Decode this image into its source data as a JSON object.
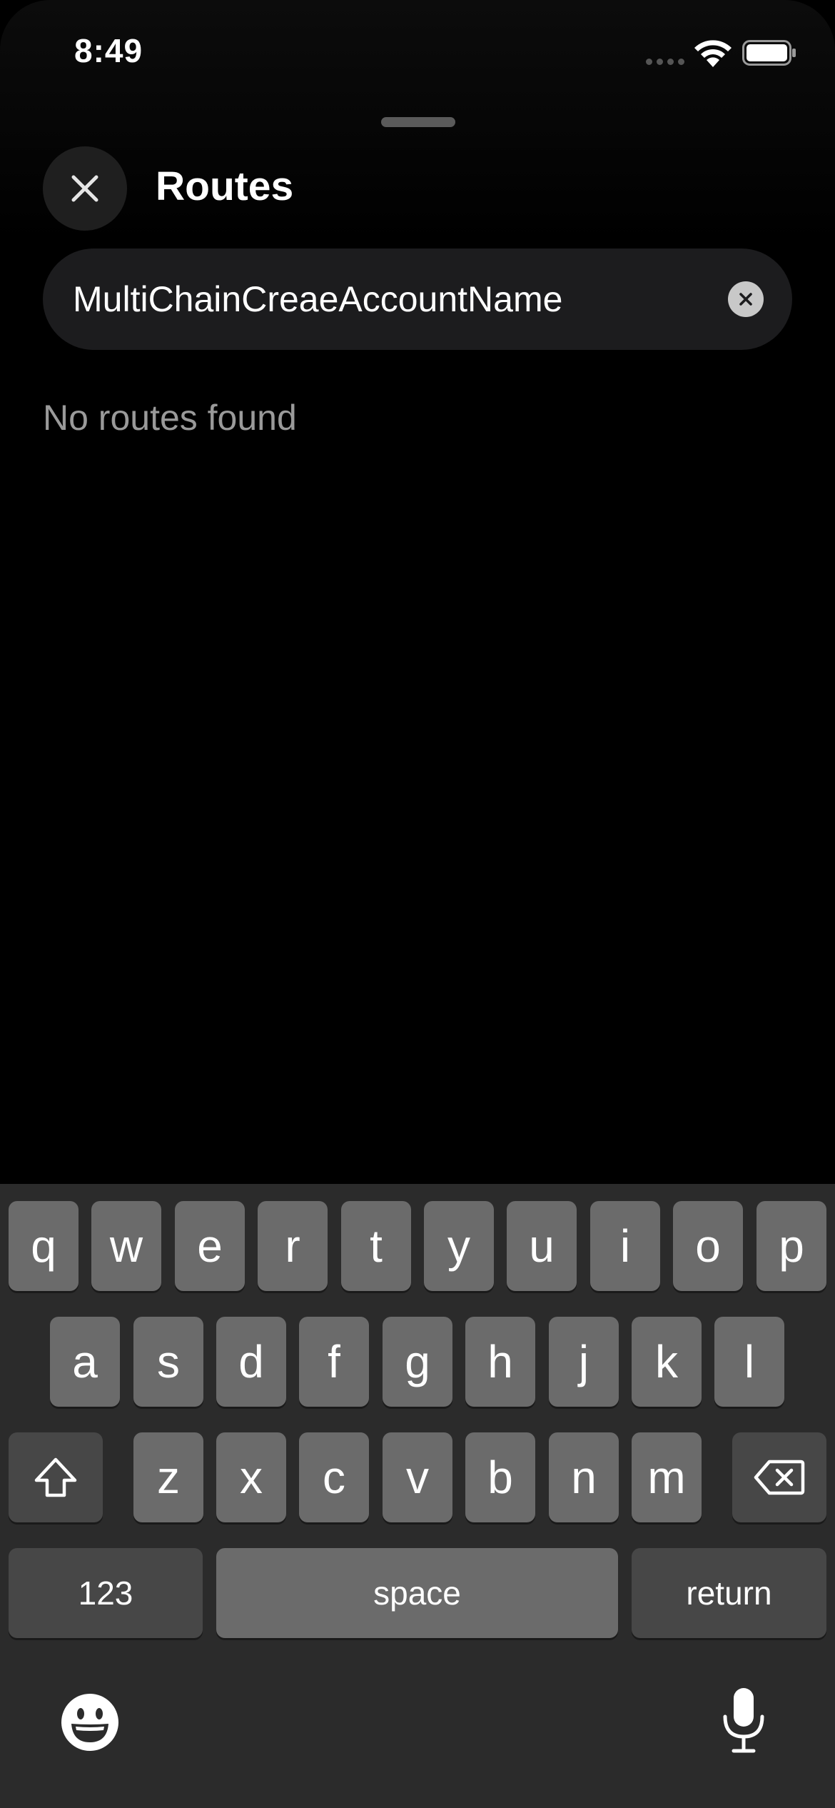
{
  "status_bar": {
    "time": "8:49",
    "signal_icon": "signal-dots-icon",
    "wifi_icon": "wifi-icon",
    "battery_icon": "battery-icon"
  },
  "header": {
    "title": "Routes",
    "close_icon": "close-icon"
  },
  "search": {
    "value": "MultiChainCreaeAccountName",
    "clear_icon": "clear-icon"
  },
  "results": {
    "empty_message": "No routes found"
  },
  "keyboard": {
    "row1": [
      "q",
      "w",
      "e",
      "r",
      "t",
      "y",
      "u",
      "i",
      "o",
      "p"
    ],
    "row2": [
      "a",
      "s",
      "d",
      "f",
      "g",
      "h",
      "j",
      "k",
      "l"
    ],
    "row3": [
      "z",
      "x",
      "c",
      "v",
      "b",
      "n",
      "m"
    ],
    "numbers_label": "123",
    "space_label": "space",
    "return_label": "return",
    "shift_icon": "shift-icon",
    "delete_icon": "delete-icon",
    "emoji_icon": "emoji-icon",
    "mic_icon": "microphone-icon"
  },
  "colors": {
    "background": "#000000",
    "field_background": "#1c1c1e",
    "keyboard_background": "#2b2b2b",
    "key_light": "#6b6b6b",
    "key_dark": "#474747",
    "muted_text": "#9a9a9a"
  }
}
